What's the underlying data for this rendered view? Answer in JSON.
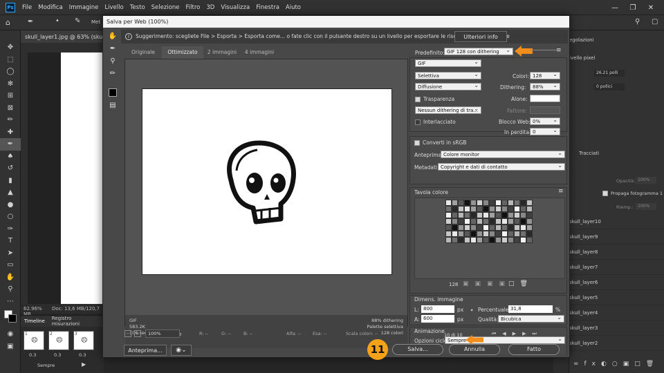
{
  "menubar": {
    "items": [
      "File",
      "Modifica",
      "Immagine",
      "Livello",
      "Testo",
      "Selezione",
      "Filtro",
      "3D",
      "Visualizza",
      "Finestra",
      "Aiuto"
    ],
    "window_buttons": [
      "—",
      "❐",
      "✕"
    ]
  },
  "optbar": {
    "label": "Met"
  },
  "document": {
    "tab_title": "skull_layer1.jpg @ 63% (skull_layer",
    "zoom": "62.96%",
    "doc_size": "Doc: 13,6 MB/120,7 MB"
  },
  "timeline": {
    "tabs": [
      "Timeline",
      "Registro misurazioni"
    ],
    "frames": [
      {
        "num": "1",
        "delay": "0.3"
      },
      {
        "num": "2",
        "delay": "0.3"
      },
      {
        "num": "3",
        "delay": "0.3"
      }
    ],
    "loop": "Sempre"
  },
  "right_panel": {
    "header": "egolazioni",
    "pixel_layer": "ivello pixel",
    "width_val": "26.21 polli",
    "height_val": "0 pollici",
    "tracks_tab": "Tracciati",
    "opacity_label": "Opacità:",
    "opacity_val": "100%",
    "fill_label": "Riemp.:",
    "fill_val": "100%",
    "propagate": "Propaga fotogramma 1",
    "layers": [
      "skull_layer10",
      "skull_layer9",
      "skull_layer8",
      "skull_layer7",
      "skull_layer6",
      "skull_layer5",
      "skull_layer4",
      "skull_layer3",
      "skull_layer2"
    ]
  },
  "dialog": {
    "title": "Salva per Web (100%)",
    "hint": "Suggerimento: scegliete File > Esporta > Esporta come... o fate clic con il pulsante destro su un livello per esportare le risorse più velocemente",
    "more_info": "Ulteriori info",
    "tabs": [
      "Originale",
      "Ottimizzato",
      "2 immagini",
      "4 immagini"
    ],
    "info_left": [
      "GIF",
      "583.2K",
      "106 sec @ 56,6 Kbps"
    ],
    "info_right": [
      "88% dithering",
      "Palette selettiva",
      "128 colori"
    ],
    "status": {
      "zoom": "100%",
      "r": "R: --",
      "g": "G: --",
      "b": "B: --",
      "alfa": "Alfa: --",
      "esa": "Esa: --",
      "index": "Scala colori: --"
    },
    "preset_label": "Predefinito:",
    "preset_value": "GIF 128 con dithering",
    "format": "GIF",
    "reduction": "Selettiva",
    "colors_label": "Colori:",
    "colors_val": "128",
    "dither_algo": "Diffusione",
    "dither_label": "Dithering:",
    "dither_val": "88%",
    "transparency": "Trasparenza",
    "matte_label": "Alone:",
    "trans_dither": "Nessun dithering di tra...",
    "amount_label": "Fattore:",
    "interlaced": "Interlacciato",
    "web_snap_label": "Blocco Web:",
    "web_snap_val": "0%",
    "lossy_label": "In perdita:",
    "lossy_val": "0",
    "srgb": "Converti in sRGB",
    "preview_label": "Anteprima:",
    "preview_val": "Colore monitor",
    "metadata_label": "Metadati:",
    "metadata_val": "Copyright e dati di contatto",
    "color_table": "Tavola colore",
    "color_count": "128",
    "image_size": "Dimens. immagine",
    "w_label": "L:",
    "w_val": "800",
    "h_label": "A:",
    "h_val": "600",
    "px": "px",
    "percent_label": "Percentuale:",
    "percent_val": "31,8",
    "percent_unit": "%",
    "quality_label": "Qualità:",
    "quality_val": "Bicubica",
    "animation": "Animazione",
    "loop_label": "Opzioni ciclo:",
    "loop_val": "Sempre",
    "frame_counter": "10 di 10",
    "preview_btn": "Anteprima...",
    "save_btn": "Salva...",
    "cancel_btn": "Annulla",
    "done_btn": "Fatto",
    "step_badge": "11"
  },
  "colors": {
    "accent_arrow": "#f28c1a",
    "badge": "#f4a21a"
  }
}
